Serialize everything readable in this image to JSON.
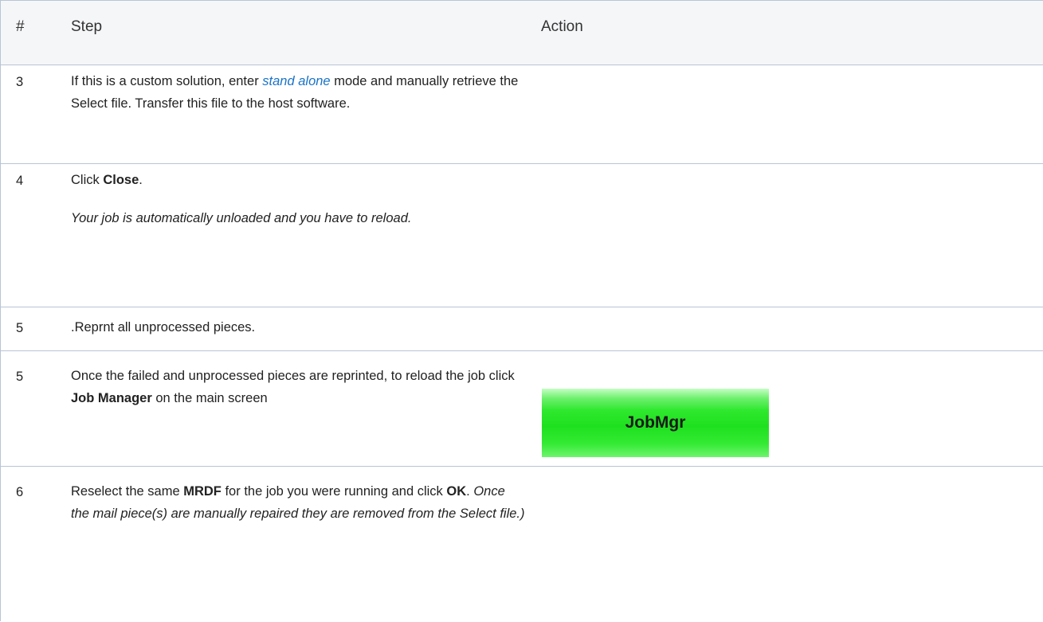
{
  "header": {
    "num": "#",
    "step": "Step",
    "action": "Action"
  },
  "rows": [
    {
      "num": "3",
      "step": {
        "t1": "If this is a custom solution, enter ",
        "link": "stand alone",
        "t2": " mode and manually retrieve the Select file. Transfer this file to the host software."
      }
    },
    {
      "num": "4",
      "step": {
        "t1": "Click ",
        "b1": "Close",
        "t2": ".",
        "note": " Your job is automatically unloaded and you have to reload."
      }
    },
    {
      "num": "5",
      "step": {
        "t1": ".Reprnt all unprocessed pieces."
      }
    },
    {
      "num": "5",
      "step": {
        "t1": "Once the failed and unprocessed pieces are reprinted, to reload the job click ",
        "b1": "Job Manager",
        "t2": " on the main screen"
      },
      "action_button": "JobMgr"
    },
    {
      "num": "6",
      "step": {
        "t1": "Reselect the same ",
        "b1": "MRDF",
        "t2": " for the job you were running and click ",
        "b2": "OK",
        "t3": ". ",
        "i1": "Once the mail piece(s) are manually repaired they are removed from the Select file.)"
      }
    }
  ]
}
